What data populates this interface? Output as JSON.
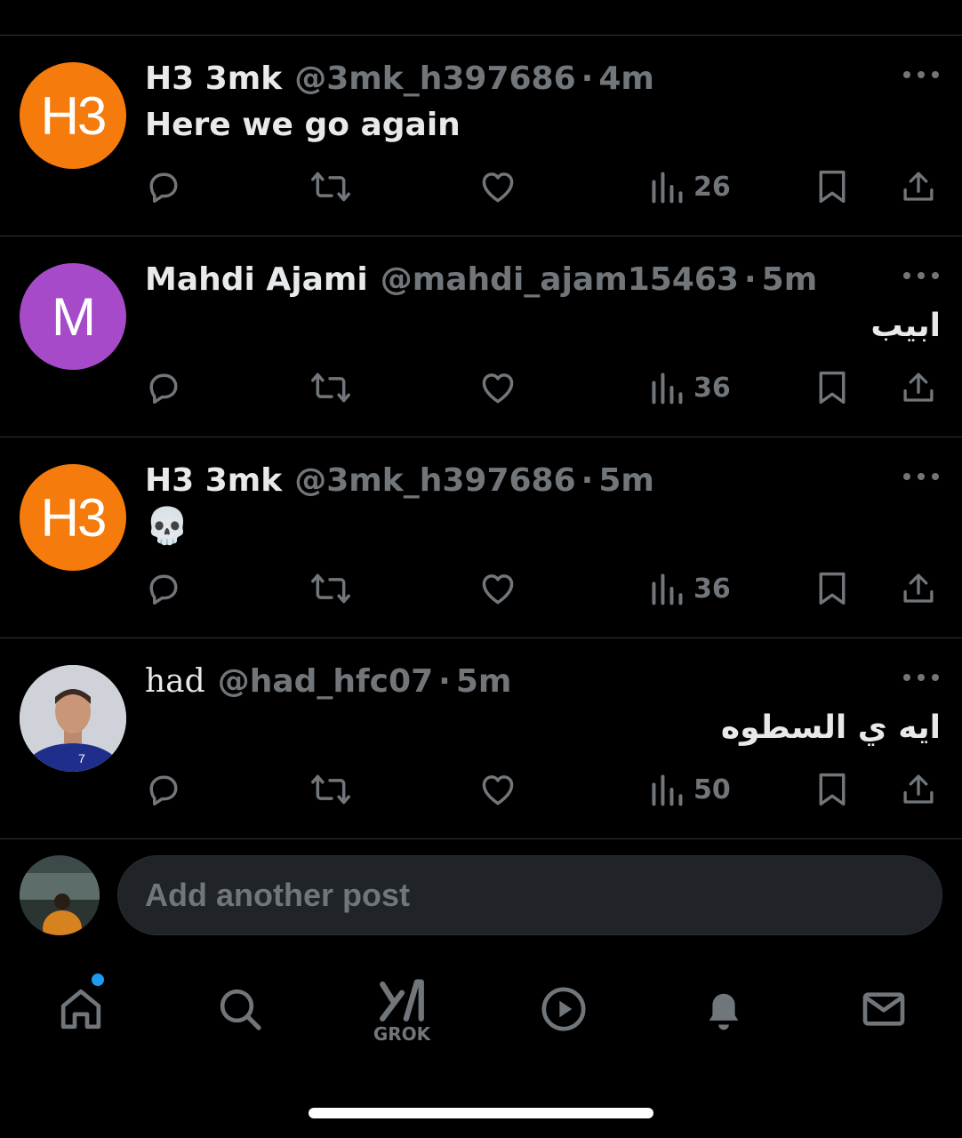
{
  "posts": [
    {
      "avatar_text": "H3",
      "avatar_color": "#f47b0c",
      "display_name": "H3 3mk",
      "handle": "@3mk_h397686",
      "time": "4m",
      "text": "Here we go again",
      "views": "26"
    },
    {
      "avatar_text": "M",
      "avatar_color": "#a64ac9",
      "display_name": "Mahdi Ajami",
      "handle": "@mahdi_ajam15463",
      "time": "5m",
      "text": "ابيب",
      "views": "36"
    },
    {
      "avatar_text": "H3",
      "avatar_color": "#f47b0c",
      "display_name": "H3 3mk",
      "handle": "@3mk_h397686",
      "time": "5m",
      "text": "💀",
      "views": "36"
    },
    {
      "avatar_text": "",
      "avatar_color": "#c9ccd4",
      "display_name": "had",
      "handle": "@had_hfc07",
      "time": "5m",
      "text": "ايه ي السطوه",
      "views": "50"
    }
  ],
  "separator": "·",
  "compose": {
    "placeholder": "Add another post"
  },
  "tabbar": {
    "grok_label": "GROK"
  },
  "colors": {
    "background": "#000000",
    "muted": "#71767b",
    "accent": "#1d9bf0",
    "text": "#e7e9ea"
  }
}
